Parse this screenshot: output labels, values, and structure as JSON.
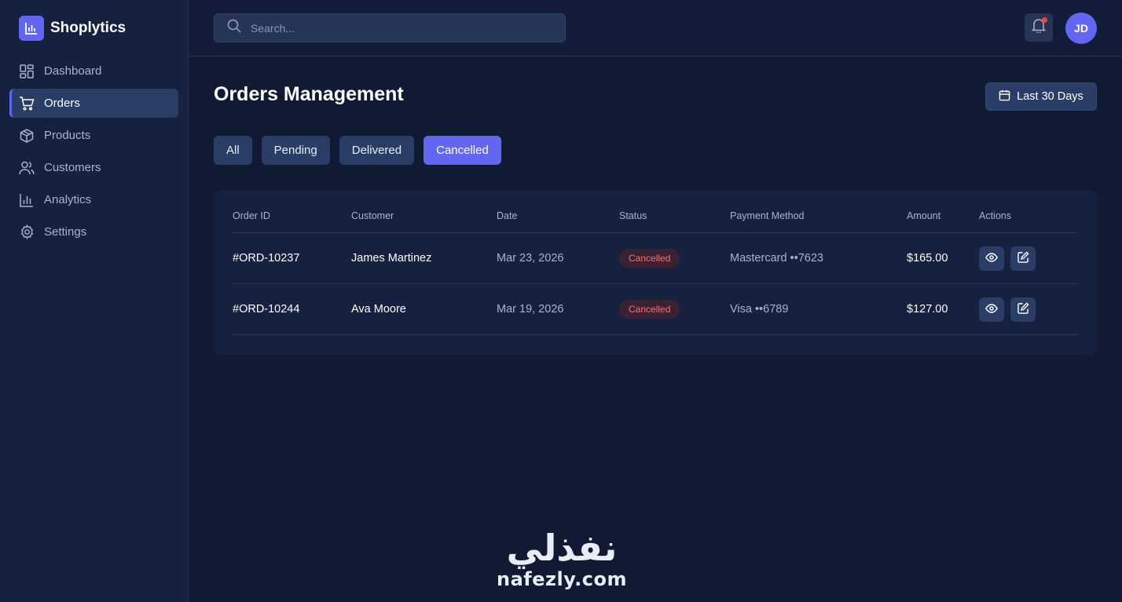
{
  "app": {
    "name": "Shoplytics"
  },
  "sidebar": {
    "items": [
      {
        "label": "Dashboard",
        "icon": "dashboard-icon"
      },
      {
        "label": "Orders",
        "icon": "cart-icon",
        "active": true
      },
      {
        "label": "Products",
        "icon": "box-icon"
      },
      {
        "label": "Customers",
        "icon": "users-icon"
      },
      {
        "label": "Analytics",
        "icon": "bar-chart-icon"
      },
      {
        "label": "Settings",
        "icon": "gear-icon"
      }
    ]
  },
  "header": {
    "search_placeholder": "Search...",
    "notification_dot_color": "#ef4444",
    "avatar_initials": "JD"
  },
  "main": {
    "title": "Orders Management",
    "date_range_label": "Last 30 Days",
    "tabs": [
      {
        "label": "All"
      },
      {
        "label": "Pending"
      },
      {
        "label": "Delivered"
      },
      {
        "label": "Cancelled",
        "active": true
      }
    ],
    "table": {
      "columns": [
        "Order ID",
        "Customer",
        "Date",
        "Status",
        "Payment Method",
        "Amount",
        "Actions"
      ],
      "rows": [
        {
          "order_id": "#ORD-10237",
          "customer": "James Martinez",
          "date": "Mar 23, 2026",
          "status": "Cancelled",
          "payment": "Mastercard ••7623",
          "amount": "$165.00"
        },
        {
          "order_id": "#ORD-10244",
          "customer": "Ava Moore",
          "date": "Mar 19, 2026",
          "status": "Cancelled",
          "payment": "Visa ••6789",
          "amount": "$127.00"
        }
      ]
    }
  },
  "watermark": {
    "arabic": "نفذلي",
    "latin": "nafezly.com"
  },
  "colors": {
    "accent": "#6366f1",
    "background": "#111a33",
    "sidebar": "#16213f",
    "cancelled": "#f87171"
  }
}
